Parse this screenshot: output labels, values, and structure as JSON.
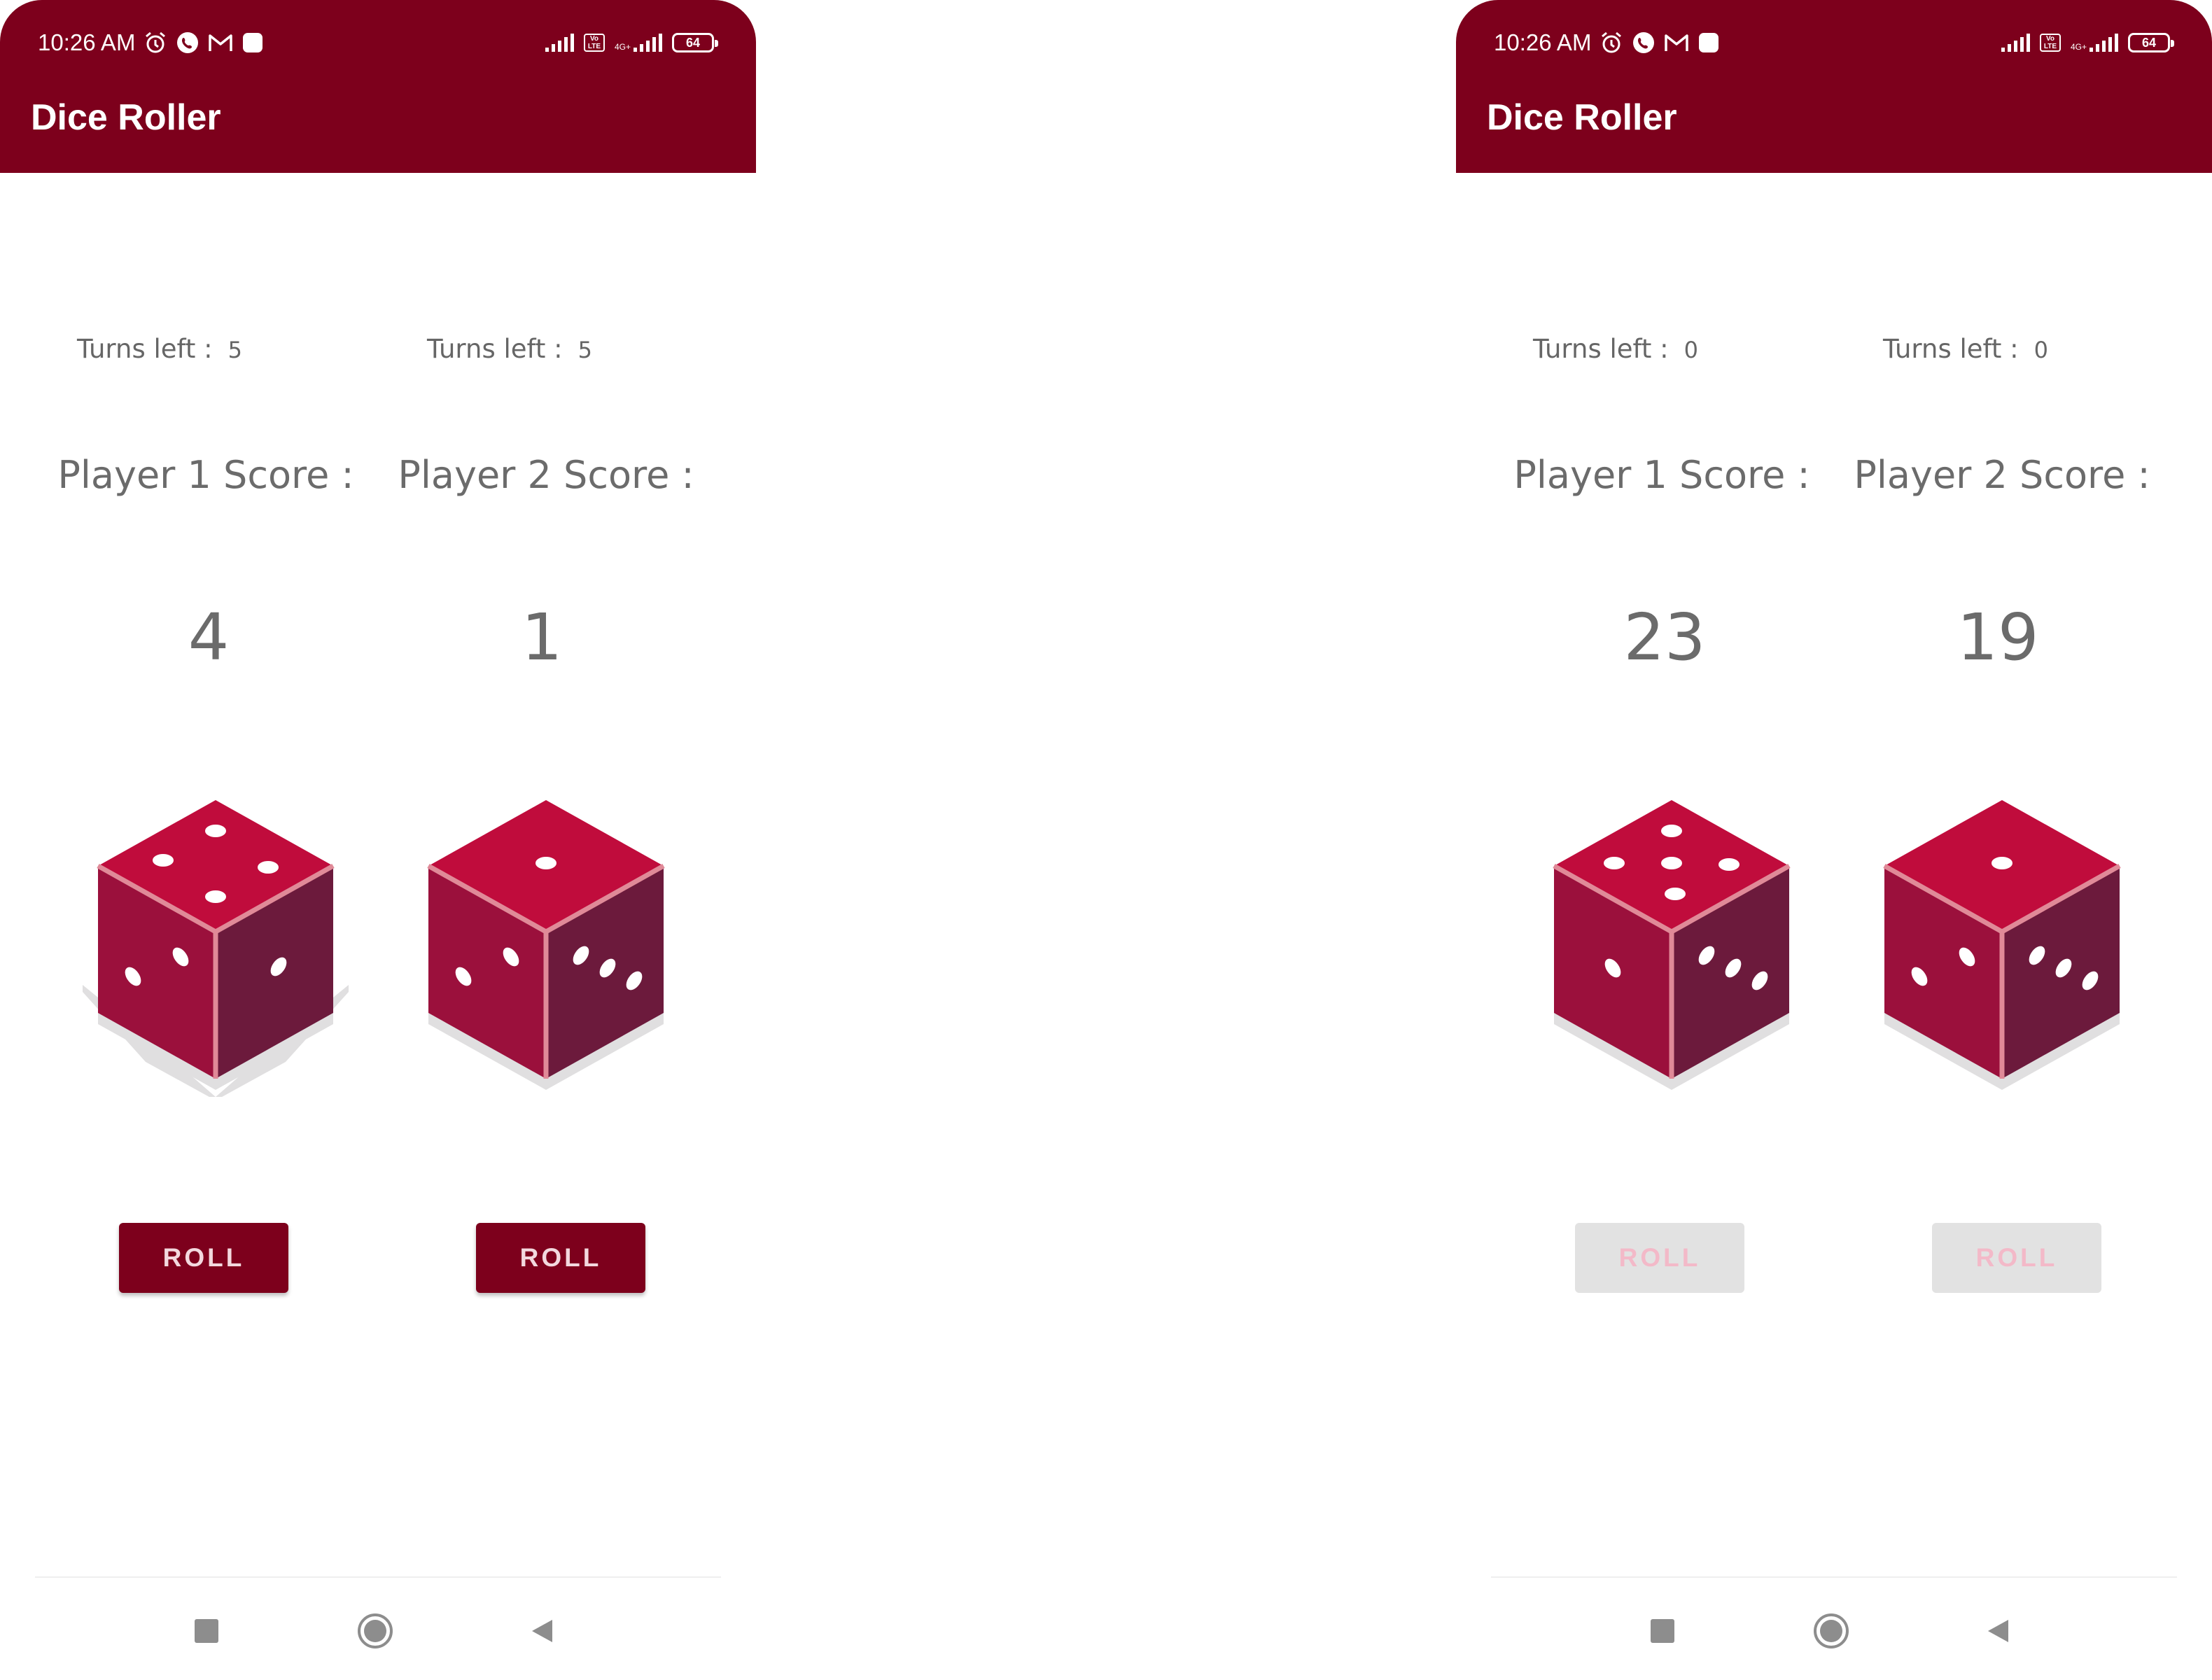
{
  "colors": {
    "app_bar": "#7d001c",
    "die_top": "#c00c3c",
    "die_left": "#9b103c",
    "die_right": "#6c1a3c",
    "button_enabled": "#7d001c",
    "button_disabled": "#e2e2e2"
  },
  "screens": [
    {
      "status": {
        "time": "10:26 AM",
        "battery": "64",
        "network": "4G+",
        "volte": "Vo LTE"
      },
      "app_title": "Dice Roller",
      "players": [
        {
          "turns_label": "Turns left :",
          "turns_value": "5",
          "score_label": "Player 1 Score :",
          "score": "4",
          "die_top_face": 4,
          "button_label": "ROLL",
          "button_state": "enabled"
        },
        {
          "turns_label": "Turns left :",
          "turns_value": "5",
          "score_label": "Player 2 Score :",
          "score": "1",
          "die_top_face": 1,
          "button_label": "ROLL",
          "button_state": "enabled"
        }
      ],
      "nav_icons": [
        "recents-square-icon",
        "home-circle-icon",
        "back-triangle-icon"
      ]
    },
    {
      "status": {
        "time": "10:26 AM",
        "battery": "64",
        "network": "4G+",
        "volte": "Vo LTE"
      },
      "app_title": "Dice Roller",
      "players": [
        {
          "turns_label": "Turns left :",
          "turns_value": "0",
          "score_label": "Player 1 Score :",
          "score": "23",
          "die_top_face": 5,
          "button_label": "ROLL",
          "button_state": "disabled"
        },
        {
          "turns_label": "Turns left :",
          "turns_value": "0",
          "score_label": "Player 2 Score :",
          "score": "19",
          "die_top_face": 1,
          "button_label": "ROLL",
          "button_state": "disabled"
        }
      ],
      "nav_icons": [
        "recents-square-icon",
        "home-circle-icon",
        "back-triangle-icon"
      ]
    }
  ]
}
